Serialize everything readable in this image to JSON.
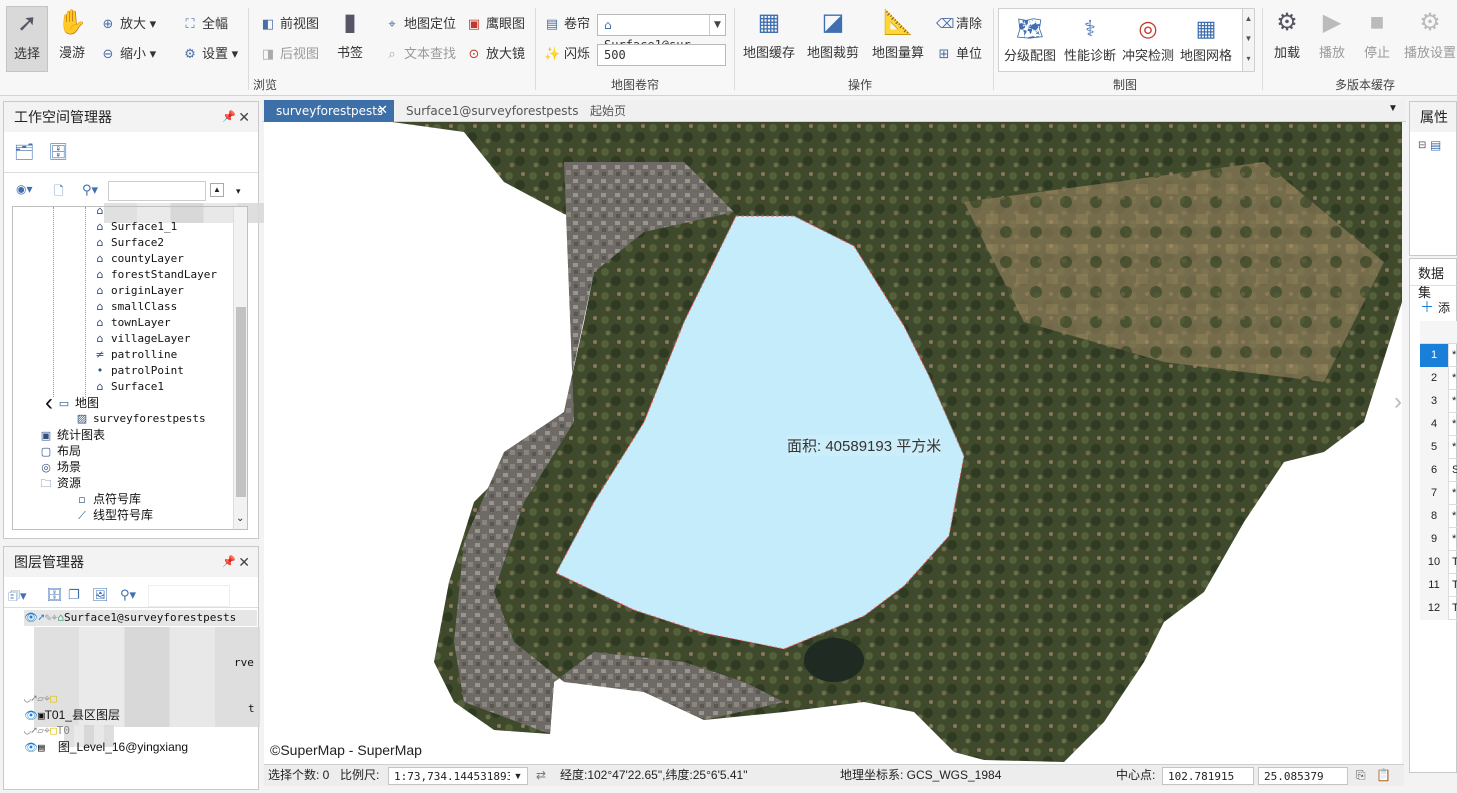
{
  "ribbon": {
    "select": "选择",
    "pan": "漫游",
    "zoom_in": "放大",
    "zoom_out": "缩小",
    "full_extent": "全幅",
    "settings": "设置",
    "prev_view": "前视图",
    "next_view": "后视图",
    "bookmark": "书签",
    "map_locate": "地图定位",
    "text_search": "文本查找",
    "eagle_eye": "鹰眼图",
    "magnifier": "放大镜",
    "browse_group": "浏览",
    "swipe": "卷帘",
    "swipe_layer": "Surface1@sur...",
    "flash": "闪烁",
    "flash_value": "500",
    "swipe_group": "地图卷帘",
    "map_cache": "地图缓存",
    "map_clip": "地图裁剪",
    "map_measure": "地图量算",
    "clear": "清除",
    "unit": "单位",
    "operate_group": "操作",
    "gallery": [
      "分级配图",
      "性能诊断",
      "冲突检测",
      "地图网格"
    ],
    "draw_group": "制图",
    "load": "加载",
    "play": "播放",
    "stop": "停止",
    "play_settings": "播放设置",
    "cache_group": "多版本缓存"
  },
  "workspace": {
    "title": "工作空间管理器",
    "layers": [
      "Surface1_1",
      "Surface2",
      "countyLayer",
      "forestStandLayer",
      "originLayer",
      "smallClass",
      "townLayer",
      "villageLayer",
      "patrolline",
      "patrolPoint",
      "Surface1"
    ],
    "maps_node": "地图",
    "map_item": "surveyforestpests",
    "chart_node": "统计图表",
    "layout_node": "布局",
    "scene_node": "场景",
    "resource_node": "资源",
    "point_lib": "点符号库",
    "line_lib": "线型符号库"
  },
  "layer_manager": {
    "title": "图层管理器",
    "rows": [
      "Surface1@surveyforestpests",
      "T01_县区图层",
      "图_Level_16@yingxiang"
    ],
    "partial": [
      "rve",
      "t",
      "T0"
    ]
  },
  "tabs": [
    "surveyforestpests",
    "Surface1@surveyforestpests",
    "起始页"
  ],
  "map": {
    "area_label": "面积: 40589193 平方米",
    "copyright": "©SuperMap - SuperMap"
  },
  "status": {
    "select_count_label": "选择个数: 0",
    "scale_label": "比例尺:",
    "scale_value": "1:73,734.1445318936",
    "coords": "经度:102°47'22.65\",纬度:25°6'5.41\"",
    "crs": "地理坐标系: GCS_WGS_1984",
    "center_label": "中心点:",
    "center_x": "102.781915",
    "center_y": "25.085379"
  },
  "properties": {
    "title": "属性",
    "dataset_label": "数据集",
    "add_label": "添",
    "rows": [
      {
        "n": "1",
        "v": "*"
      },
      {
        "n": "2",
        "v": "*"
      },
      {
        "n": "3",
        "v": "*"
      },
      {
        "n": "4",
        "v": "*"
      },
      {
        "n": "5",
        "v": "*"
      },
      {
        "n": "6",
        "v": "S"
      },
      {
        "n": "7",
        "v": "*"
      },
      {
        "n": "8",
        "v": "*"
      },
      {
        "n": "9",
        "v": "*"
      },
      {
        "n": "10",
        "v": "T"
      },
      {
        "n": "11",
        "v": "T"
      },
      {
        "n": "12",
        "v": "T"
      }
    ]
  },
  "colors": {
    "accent": "#3d6fa8",
    "polygon_fill": "#c4ecfb",
    "polygon_stroke": "#e05a5a",
    "selected_row": "#1a7fd9"
  }
}
